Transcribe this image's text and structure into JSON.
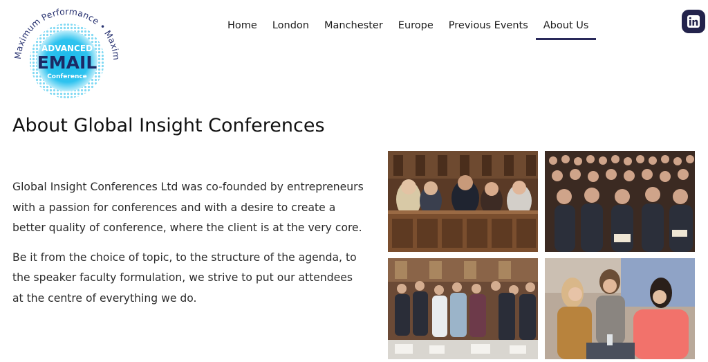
{
  "header": {
    "logo": {
      "ring_text": "Maximum Performance • Maximum Impact",
      "line1": "ADVANCED",
      "line2": "EMAIL",
      "line3": "Conference"
    },
    "nav": [
      {
        "label": "Home",
        "active": false
      },
      {
        "label": "London",
        "active": false
      },
      {
        "label": "Manchester",
        "active": false
      },
      {
        "label": "Europe",
        "active": false
      },
      {
        "label": "Previous Events",
        "active": false
      },
      {
        "label": "About Us",
        "active": true
      }
    ],
    "social": {
      "icon": "linkedin-icon",
      "label": "in"
    }
  },
  "main": {
    "title": "About Global Insight Conferences",
    "paragraphs": [
      "Global Insight Conferences Ltd was co-founded by entrepreneurs with a passion for conferences and with a desire to create a better quality of conference, where the client is at the very core.",
      "Be it from the choice of topic, to the structure of the agenda, to the speaker faculty formulation, we strive to put our attendees at the centre of everything we do."
    ]
  },
  "colors": {
    "accent": "#29295a",
    "logo_blue": "#1ab9ea",
    "logo_text": "#1c2a66"
  }
}
